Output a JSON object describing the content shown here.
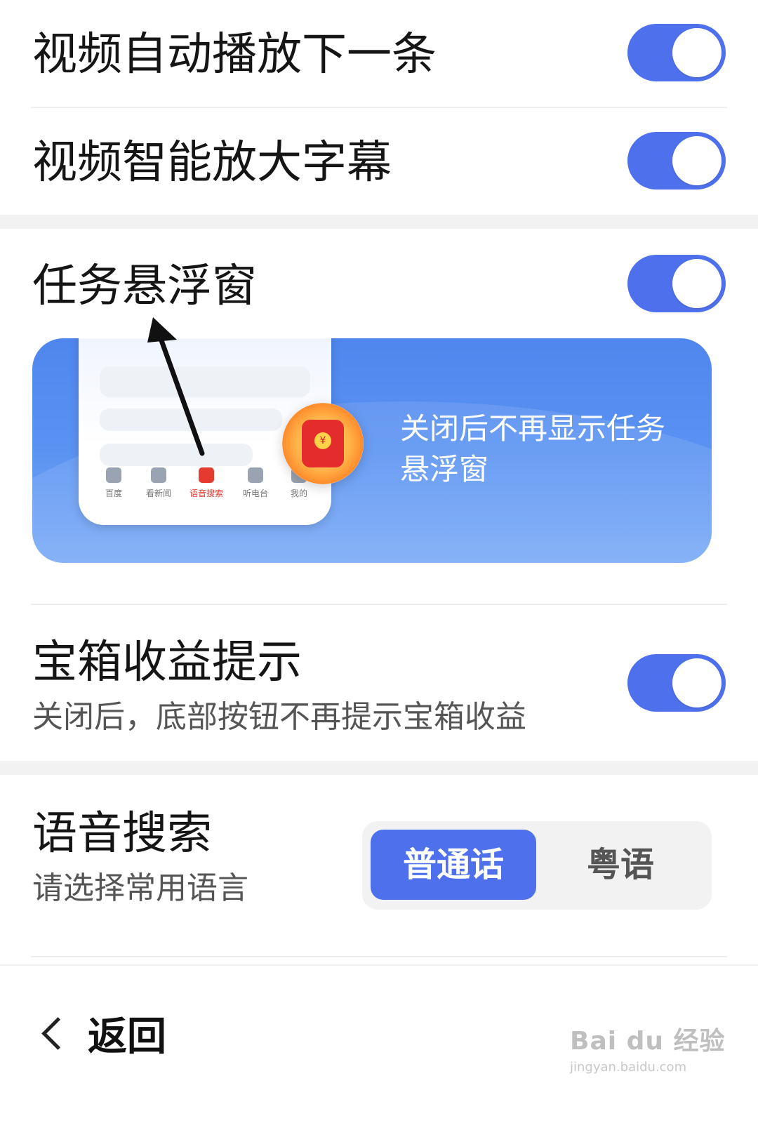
{
  "settings": {
    "autoplay": {
      "title": "视频自动播放下一条",
      "enabled": true
    },
    "subtitles": {
      "title": "视频智能放大字幕",
      "enabled": true
    },
    "task_float": {
      "title": "任务悬浮窗",
      "enabled": true,
      "preview_text": "关闭后不再显示任务悬浮窗",
      "preview_tabs": [
        "百度",
        "看新闻",
        "语音搜索",
        "听电台",
        "我的"
      ]
    },
    "treasure": {
      "title": "宝箱收益提示",
      "subtitle": "关闭后，底部按钮不再提示宝箱收益",
      "enabled": true
    },
    "voice_search": {
      "title": "语音搜索",
      "subtitle": "请选择常用语言",
      "options": [
        "普通话",
        "粤语"
      ],
      "selected": "普通话"
    }
  },
  "footer": {
    "back_label": "返回"
  },
  "watermark": {
    "line1": "Bai du 经验",
    "line2": "jingyan.baidu.com"
  },
  "colors": {
    "accent": "#4f70ec",
    "background": "#ffffff",
    "section_band": "#f2f2f2"
  },
  "icons": [
    "chevron-left-icon",
    "red-envelope-icon",
    "pointer-arrow"
  ]
}
